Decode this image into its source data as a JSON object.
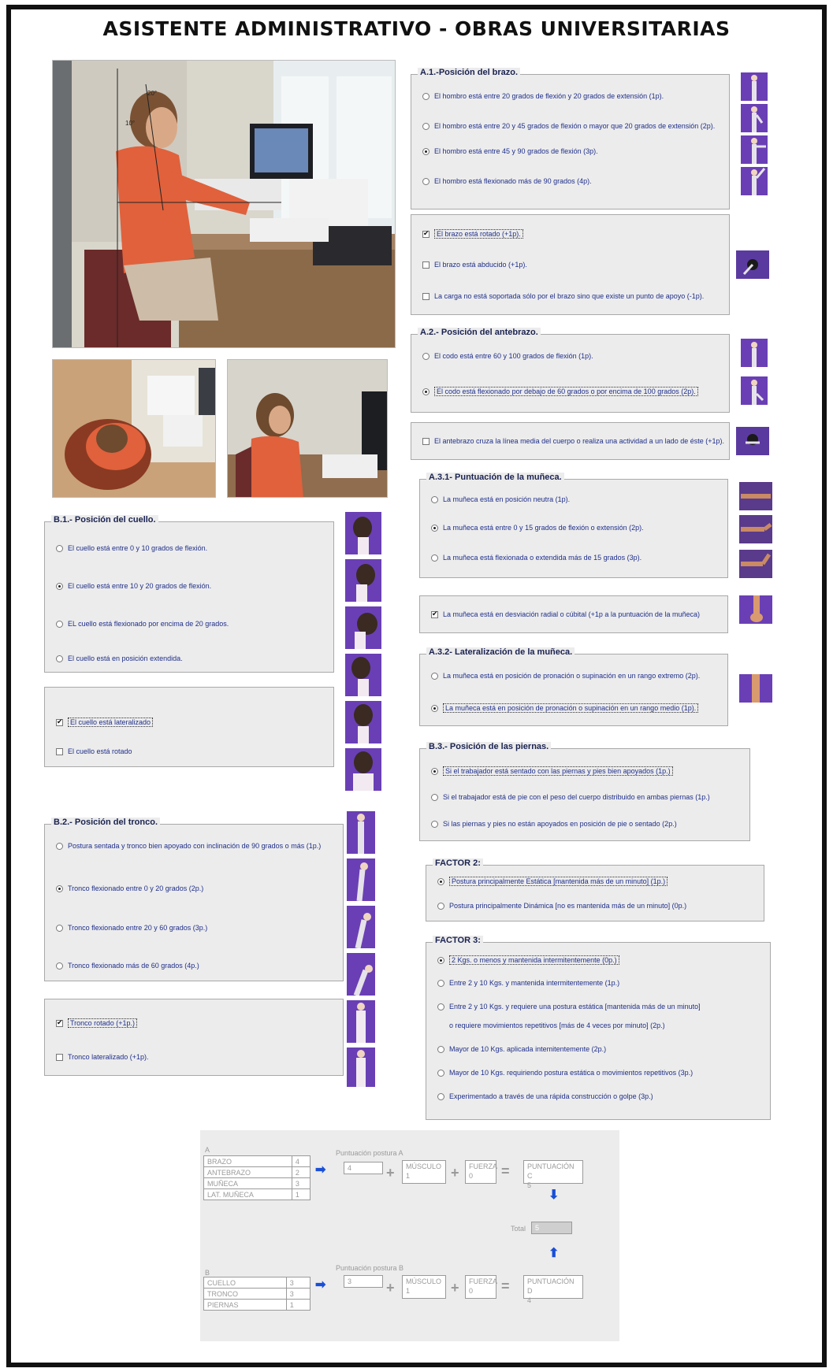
{
  "title": "ASISTENTE ADMINISTRATIVO - OBRAS UNIVERSITARIAS",
  "photo_labels": {
    "angle1": "20°",
    "angle2": "10°"
  },
  "a1": {
    "title": "A.1.-Posición del brazo.",
    "options": [
      "El hombro está entre 20 grados de flexión y 20 grados de extensión (1p).",
      "El hombro está entre 20 y 45 grados de flexión o mayor que 20 grados de extensión (2p).",
      "El hombro  está entre 45 y 90 grados de flexión (3p).",
      "El hombro está flexionado más de 90 grados (4p)."
    ],
    "checks": [
      "El brazo está rotado  (+1p).",
      "El brazo está abducido  (+1p).",
      "La carga no está soportada sólo por el brazo sino que existe un punto de apoyo (-1p)."
    ]
  },
  "a2": {
    "title": "A.2.- Posición del antebrazo.",
    "options": [
      "El codo está entre 60 y 100 grados de flexión (1p).",
      "El codo está flexionado por debajo de 60 grados o por encima de 100 grados (2p)."
    ],
    "check": "El antebrazo cruza la línea media del cuerpo o realiza una actividad a un lado de éste  (+1p)."
  },
  "a31": {
    "title": "A.3.1- Puntuación de la muñeca.",
    "options": [
      "La muñeca está en posición neutra (1p).",
      "La muñeca está entre 0 y 15 grados de flexión o extensión (2p).",
      "La muñeca está flexionada o extendida más de 15 grados  (3p)."
    ],
    "check": "La muñeca está en desviación radial o cúbital (+1p a la puntuación de la muñeca)"
  },
  "a32": {
    "title": "A.3.2- Lateralización de la muñeca.",
    "options": [
      "La muñeca está en posición de pronación o supinación en un rango extremo (2p).",
      "La muñeca está en posición de pronación o supinación en un rango medio (1p)."
    ]
  },
  "b1": {
    "title": "B.1.- Posición del cuello.",
    "options": [
      "El cuello está entre 0 y 10 grados de flexión.",
      "El cuello está entre 10 y 20 grados de flexión.",
      "EL cuello está flexionado por encima de 20 grados.",
      "El cuello está en posición extendida."
    ],
    "checks": [
      "El cuello está lateralizado",
      "El cuello está rotado"
    ]
  },
  "b2": {
    "title": "B.2.- Posición del tronco.",
    "options": [
      "Postura sentada y tronco bien apoyado con inclinación de 90 grados o más (1p.)",
      "Tronco flexionado entre 0 y 20 grados (2p.)",
      "Tronco flexionado  entre 20 y 60 grados (3p.)",
      "Tronco flexionado más de 60 grados (4p.)"
    ],
    "checks": [
      "Tronco rotado (+1p.)",
      "Tronco lateralizado (+1p)."
    ]
  },
  "b3": {
    "title": "B.3.- Posición de las piernas.",
    "options": [
      "Si el trabajador está sentado con las piernas y pies bien apoyados (1p.)",
      "Si el trabajador está de pie con el peso del cuerpo distribuido en ambas piernas  (1p.)",
      "Si las piernas y pies no están apoyados en posición de pie o sentado (2p.)"
    ]
  },
  "factor2": {
    "title": "FACTOR 2:",
    "options": [
      "Postura principalmente Estática [mantenida más de un minuto] (1p.)",
      "Postura principalmente Dinámica [no es mantenida más de un minuto] (0p.)"
    ]
  },
  "factor3": {
    "title": "FACTOR 3:",
    "options": [
      "2 Kgs. o menos y mantenida intermitentemente (0p.)",
      "Entre 2 y 10 Kgs. y mantenida intermitentemente (1p.)",
      "Entre 2 y 10 Kgs. y requiere una postura estática [mantenida más de un minuto]",
      "o requiere movimientos repetitivos [más de 4 veces por minuto] (2p.)",
      "Mayor de 10 Kgs. aplicada intemitentemente (2p.)",
      "Mayor de 10 Kgs. requiriendo postura estática o movimientos repetitivos (3p.)",
      "Experimentado a través de una rápida construcción o golpe (3p.)"
    ]
  },
  "calc": {
    "a_label": "A",
    "a_rows": [
      [
        "BRAZO",
        "4"
      ],
      [
        "ANTEBRAZO",
        "2"
      ],
      [
        "MUÑECA",
        "3"
      ],
      [
        "LAT. MUÑECA",
        "1"
      ]
    ],
    "a_posture_label": "Puntuación postura A",
    "a_posture": "4",
    "a_muscle_label": "MÚSCULO",
    "a_muscle": "1",
    "a_force_label": "FUERZA",
    "a_force": "0",
    "c_label": "PUNTUACIÓN C",
    "c_value": "5",
    "total_label": "Total",
    "total_value": "5",
    "b_label": "B",
    "b_rows": [
      [
        "CUELLO",
        "3"
      ],
      [
        "TRONCO",
        "3"
      ],
      [
        "PIERNAS",
        "1"
      ]
    ],
    "b_posture_label": "Puntuación postura B",
    "b_posture": "3",
    "b_muscle_label": "MÚSCULO",
    "b_muscle": "1",
    "b_force_label": "FUERZA",
    "b_force": "0",
    "d_label": "PUNTUACIÓN D",
    "d_value": "4"
  }
}
